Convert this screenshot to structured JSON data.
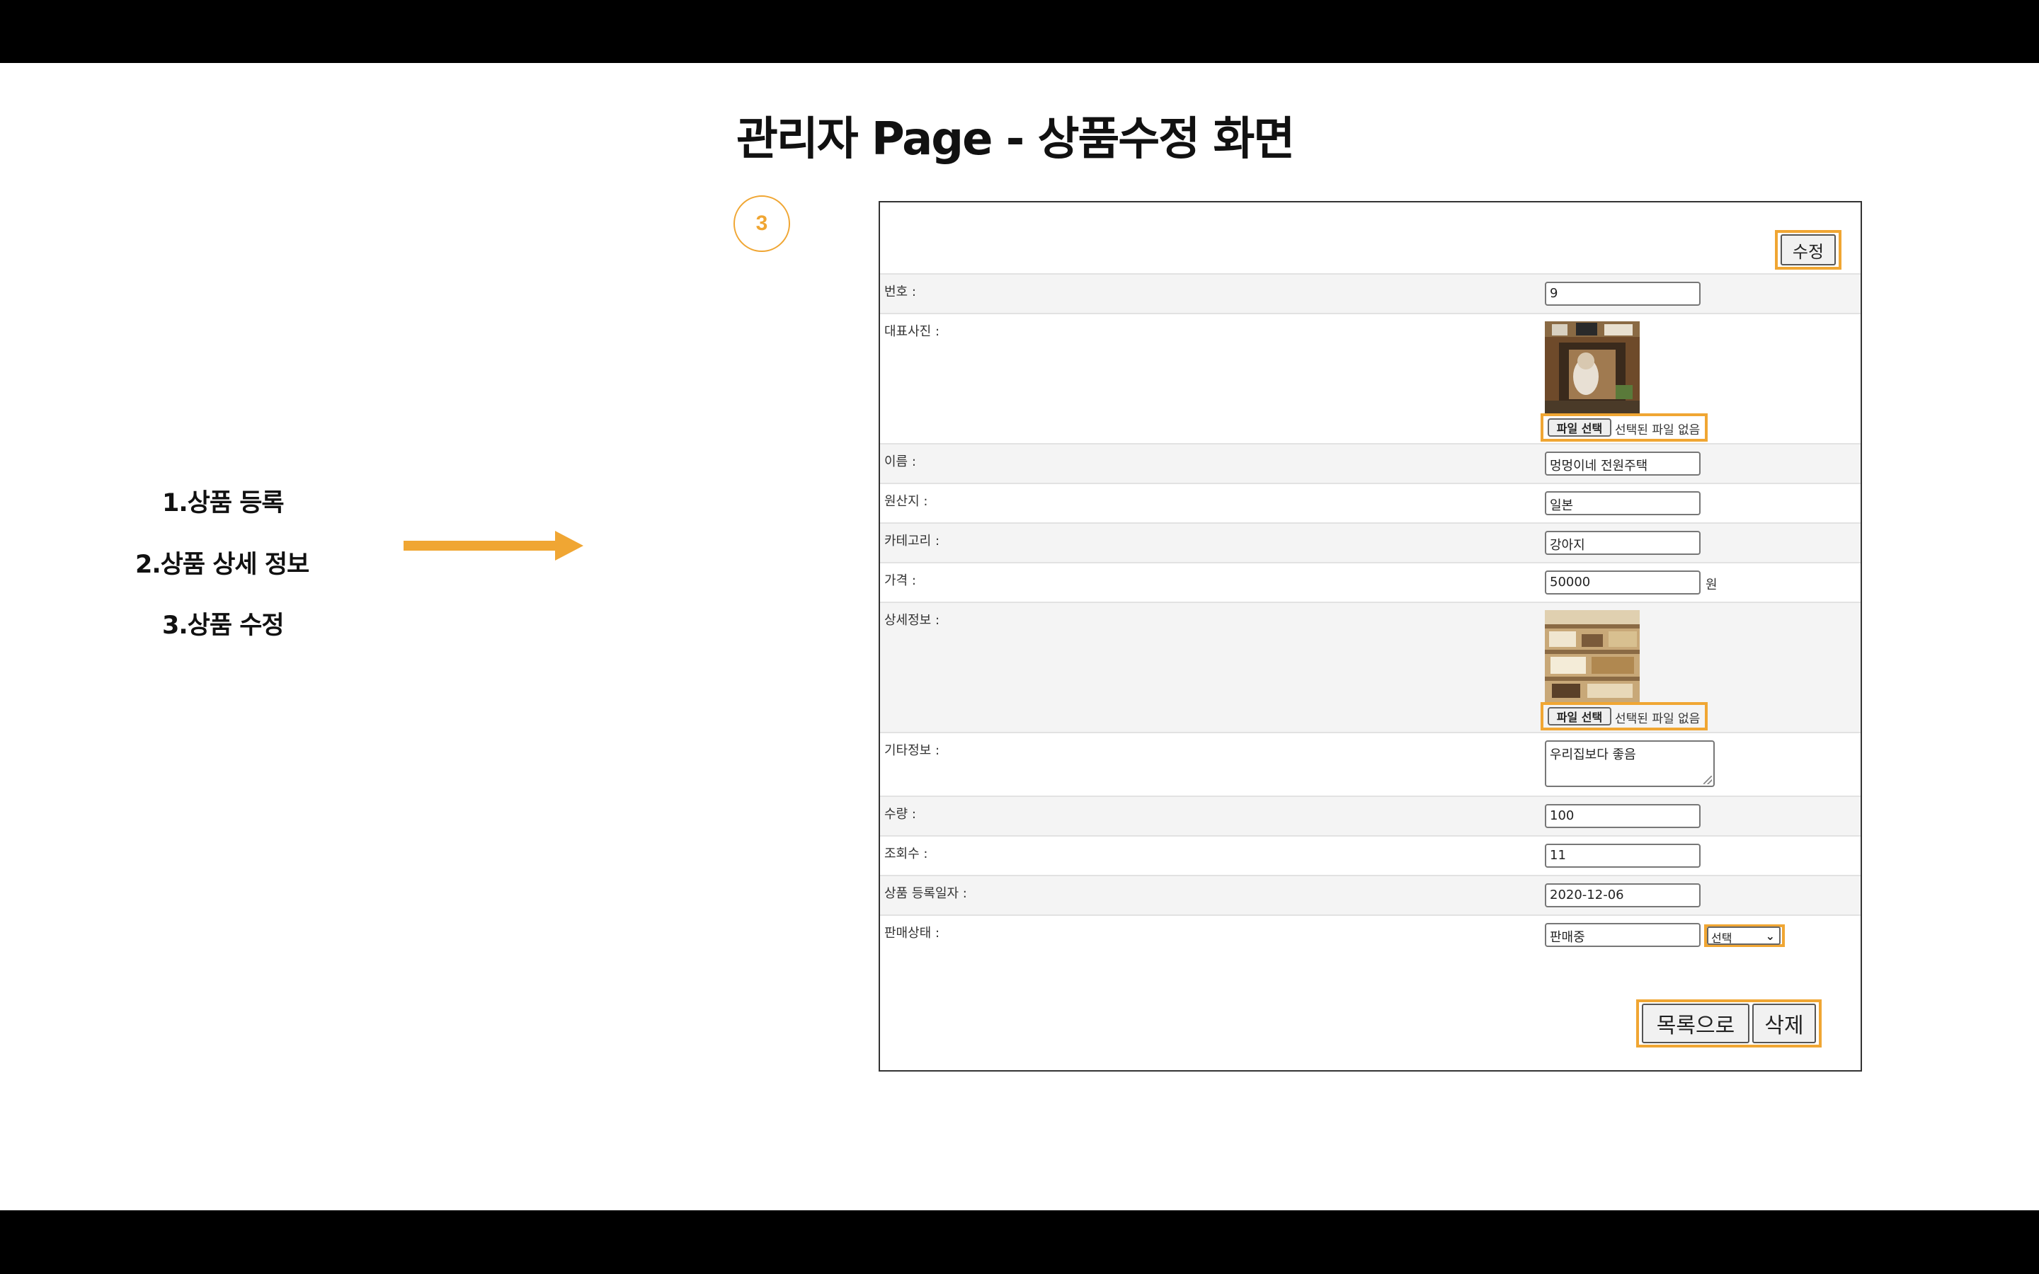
{
  "slide": {
    "title": "관리자 Page - 상품수정 화면",
    "step_number": "3",
    "menu": [
      "1.상품 등록",
      "2.상품 상세 정보",
      "3.상품 수정"
    ]
  },
  "form": {
    "edit_button": "수정",
    "fields": {
      "number": {
        "label": "번호 :",
        "value": "9"
      },
      "main_photo": {
        "label": "대표사진 :",
        "file_button": "파일 선택",
        "file_status": "선택된 파일 없음"
      },
      "name": {
        "label": "이름 :",
        "value": "멍멍이네 전원주택"
      },
      "origin": {
        "label": "원산지 :",
        "value": "일본"
      },
      "category": {
        "label": "카테고리 :",
        "value": "강아지"
      },
      "price": {
        "label": "가격 :",
        "value": "50000",
        "unit": "원"
      },
      "detail_info": {
        "label": "상세정보 :",
        "file_button": "파일 선택",
        "file_status": "선택된 파일 없음"
      },
      "etc_info": {
        "label": "기타정보 :",
        "value": "우리집보다 좋음"
      },
      "quantity": {
        "label": "수량 :",
        "value": "100"
      },
      "views": {
        "label": "조회수 :",
        "value": "11"
      },
      "reg_date": {
        "label": "상품 등록일자 :",
        "value": "2020-12-06"
      },
      "sale_status": {
        "label": "판매상태 :",
        "value": "판매중",
        "select_value": "선택"
      }
    },
    "list_button": "목록으로",
    "delete_button": "삭제"
  },
  "colors": {
    "accent": "#f0a633",
    "bars": "#000000"
  }
}
